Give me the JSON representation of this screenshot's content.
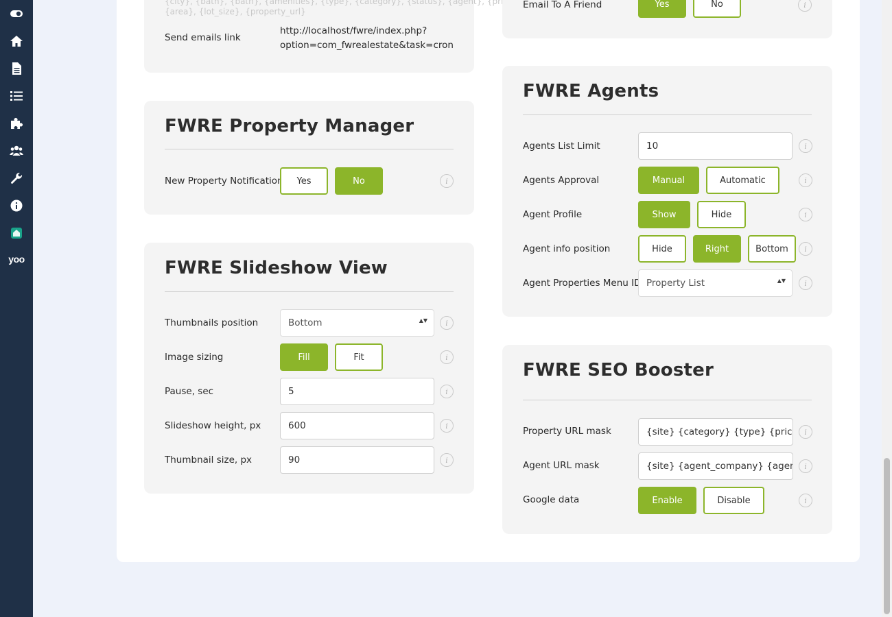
{
  "sidebar": {
    "icons": [
      "toggle-icon",
      "home-icon",
      "document-icon",
      "list-icon",
      "puzzle-icon",
      "users-icon",
      "wrench-icon",
      "info-icon",
      "house-app-icon",
      "yoo-logo-icon"
    ],
    "logo_text": "yoo"
  },
  "email_settings": {
    "faded_line1": "{city}, {bath}, {bath}, {amenities}, {type}, {category}, {status}, {agent}, {price},",
    "faded_line2": "{area}, {lot_size}, {property_url}",
    "send_emails_label": "Send emails link",
    "send_emails_value_line1": "http://localhost/fwre/index.php?",
    "send_emails_value_line2": "option=com_fwrealestate&task=cron"
  },
  "email_friend": {
    "label": "Email To A Friend",
    "yes": "Yes",
    "no": "No"
  },
  "property_manager": {
    "title": "FWRE Property Manager",
    "notification_label": "New Property Notification",
    "yes": "Yes",
    "no": "No"
  },
  "slideshow": {
    "title": "FWRE Slideshow View",
    "thumbnails_label": "Thumbnails position",
    "thumbnails_value": "Bottom",
    "image_sizing_label": "Image sizing",
    "fill": "Fill",
    "fit": "Fit",
    "pause_label": "Pause, sec",
    "pause_value": "5",
    "height_label": "Slideshow height, px",
    "height_value": "600",
    "thumb_size_label": "Thumbnail size, px",
    "thumb_size_value": "90"
  },
  "agents": {
    "title": "FWRE Agents",
    "list_limit_label": "Agents List Limit",
    "list_limit_value": "10",
    "approval_label": "Agents Approval",
    "manual": "Manual",
    "automatic": "Automatic",
    "profile_label": "Agent Profile",
    "show": "Show",
    "hide": "Hide",
    "info_position_label": "Agent info position",
    "pos_hide": "Hide",
    "pos_right": "Right",
    "pos_bottom": "Bottom",
    "menu_id_label": "Agent Properties Menu ID",
    "menu_id_value": "Property List"
  },
  "seo": {
    "title": "FWRE SEO Booster",
    "property_url_label": "Property URL mask",
    "property_url_value": "{site} {category} {type} {price}",
    "agent_url_label": "Agent URL mask",
    "agent_url_value": "{site} {agent_company} {agent_name}",
    "google_label": "Google data",
    "enable": "Enable",
    "disable": "Disable"
  },
  "info_glyph": "i",
  "colors": {
    "sidebar": "#1f3047",
    "accent": "#8cb52a",
    "panel": "#f4f4f4",
    "background": "#eef2fa"
  }
}
